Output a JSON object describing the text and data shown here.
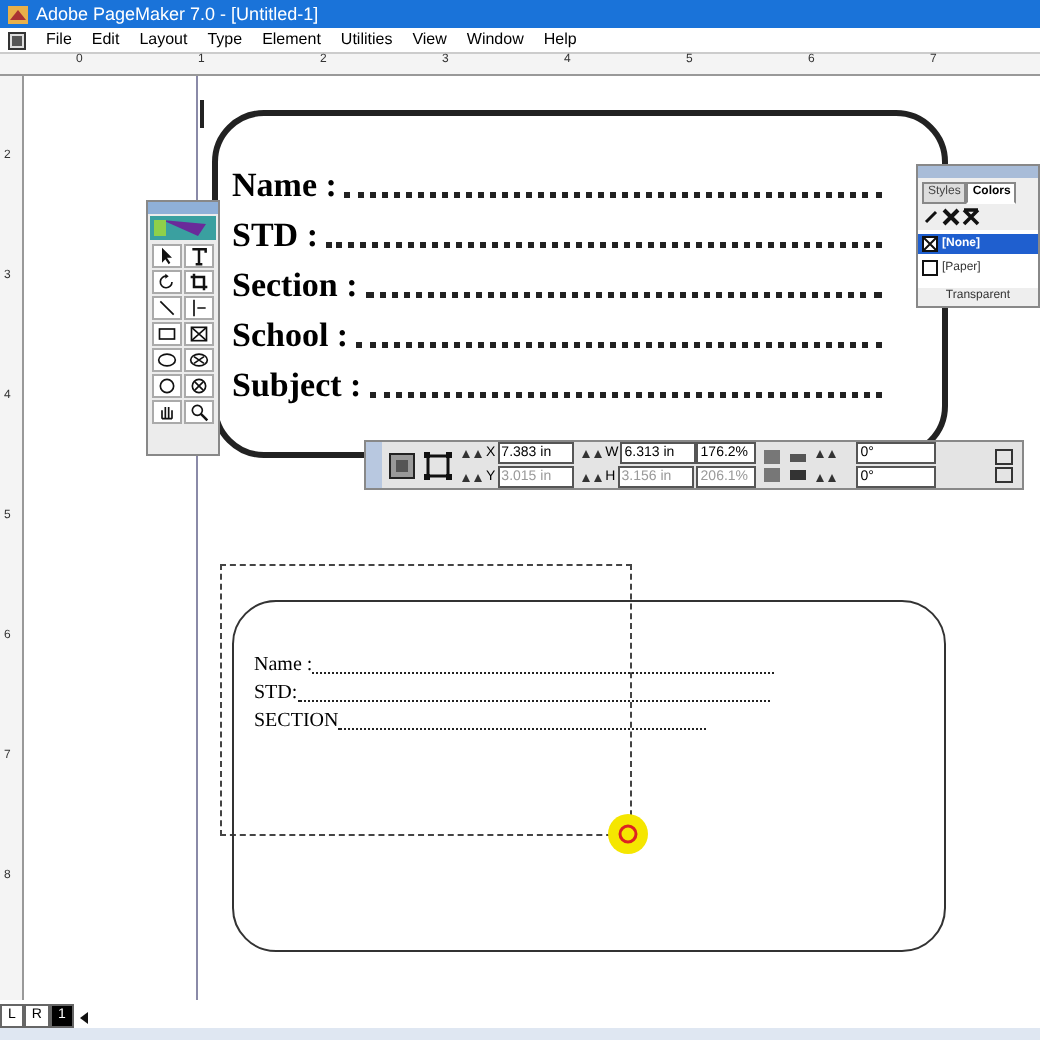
{
  "window": {
    "title": "Adobe PageMaker 7.0 - [Untitled-1]"
  },
  "menu": [
    "File",
    "Edit",
    "Layout",
    "Type",
    "Element",
    "Utilities",
    "View",
    "Window",
    "Help"
  ],
  "top_ruler": [
    "0",
    "1",
    "2",
    "3",
    "4",
    "5",
    "6",
    "7"
  ],
  "left_ruler": [
    "2",
    "3",
    "4",
    "5",
    "6",
    "7",
    "8"
  ],
  "form_box": {
    "fields": [
      "Name :",
      "STD :",
      "Section :",
      "School :",
      "Subject :"
    ]
  },
  "second_box": {
    "fields": [
      "Name :",
      "STD:",
      "SECTION"
    ]
  },
  "control_palette": {
    "x_label": "X",
    "x": "7.383 in",
    "y_label": "Y",
    "y": "3.015 in",
    "w_label": "W",
    "w": "6.313 in",
    "h_label": "H",
    "h": "3.156 in",
    "scale_w": "176.2%",
    "scale_h": "206.1%",
    "rotation": "0°",
    "skew": "0°"
  },
  "colors_palette": {
    "tabs": [
      {
        "label": "Styles",
        "selected": false
      },
      {
        "label": "Colors",
        "selected": true
      }
    ],
    "items": [
      {
        "label": "[None]",
        "selected": true
      },
      {
        "label": "[Paper]",
        "selected": false
      }
    ],
    "footer": "Transparent"
  },
  "page_tabs": [
    {
      "label": "L",
      "selected": false
    },
    {
      "label": "R",
      "selected": false
    },
    {
      "label": "1",
      "selected": true
    }
  ]
}
